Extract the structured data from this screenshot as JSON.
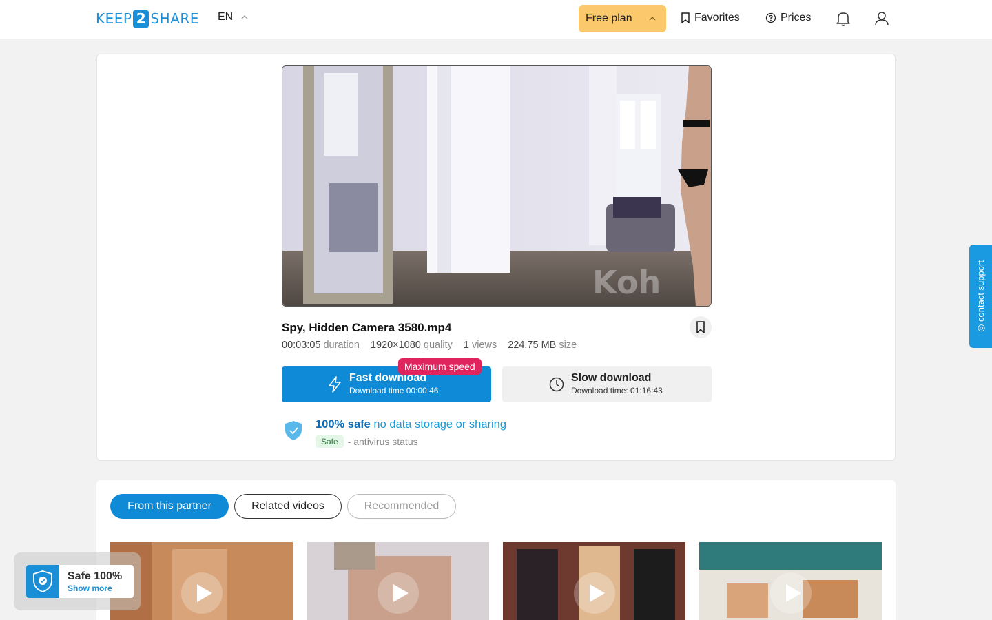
{
  "header": {
    "logo_left": "KEEP",
    "logo_mid": "2",
    "logo_right": "SHARE",
    "language": "EN",
    "plan_label": "Free plan",
    "favorites_label": "Favorites",
    "prices_label": "Prices"
  },
  "file": {
    "name": "Spy, Hidden Camera 3580.mp4",
    "duration": "00:03:05",
    "duration_label": "duration",
    "quality": "1920×1080",
    "quality_label": "quality",
    "views": "1",
    "views_label": "views",
    "size": "224.75 MB",
    "size_label": "size"
  },
  "download": {
    "fast_label": "Fast download",
    "fast_time": "Download time 00:00:46",
    "badge": "Maximum speed",
    "slow_label": "Slow download",
    "slow_time": "Download time: 01:16:43"
  },
  "safety": {
    "headline_bold": "100% safe",
    "headline_rest": "no data storage or sharing",
    "badge": "Safe",
    "status_text": "- antivirus status"
  },
  "tabs": [
    {
      "label": "From this partner",
      "active": true
    },
    {
      "label": "Related videos",
      "active": false
    },
    {
      "label": "Recommended",
      "active": false
    }
  ],
  "side_tab": {
    "label": "◎ contact support"
  },
  "safe_widget": {
    "title": "Safe 100%",
    "link": "Show more"
  },
  "colors": {
    "brand_blue": "#1a8fd8",
    "fast_button": "#0f8ad6",
    "plan_button": "#fbc96b",
    "badge_red": "#e0245e"
  }
}
